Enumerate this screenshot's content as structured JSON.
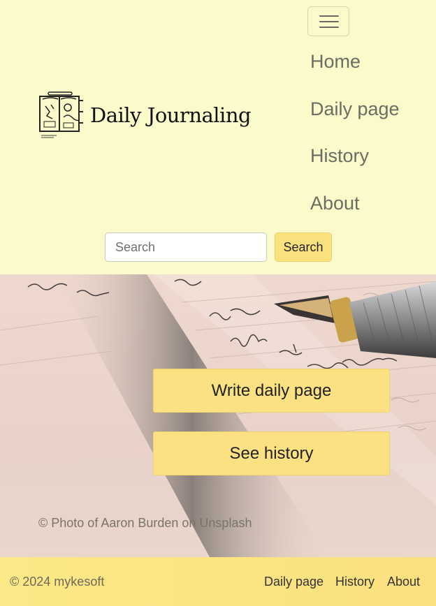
{
  "navbar": {
    "brand_title": "Daily Journaling",
    "links": [
      "Home",
      "Daily page",
      "History",
      "About"
    ]
  },
  "search": {
    "placeholder": "Search",
    "button_label": "Search"
  },
  "hero": {
    "write_button": "Write daily page",
    "history_button": "See history",
    "photo_credit": "© Photo of Aaron Burden on Unsplash"
  },
  "footer": {
    "copyright": "© 2024 mykesoft",
    "links": [
      "Daily page",
      "History",
      "About"
    ]
  },
  "colors": {
    "header_bg": "#fafacb",
    "accent_yellow": "#fbe27f"
  }
}
